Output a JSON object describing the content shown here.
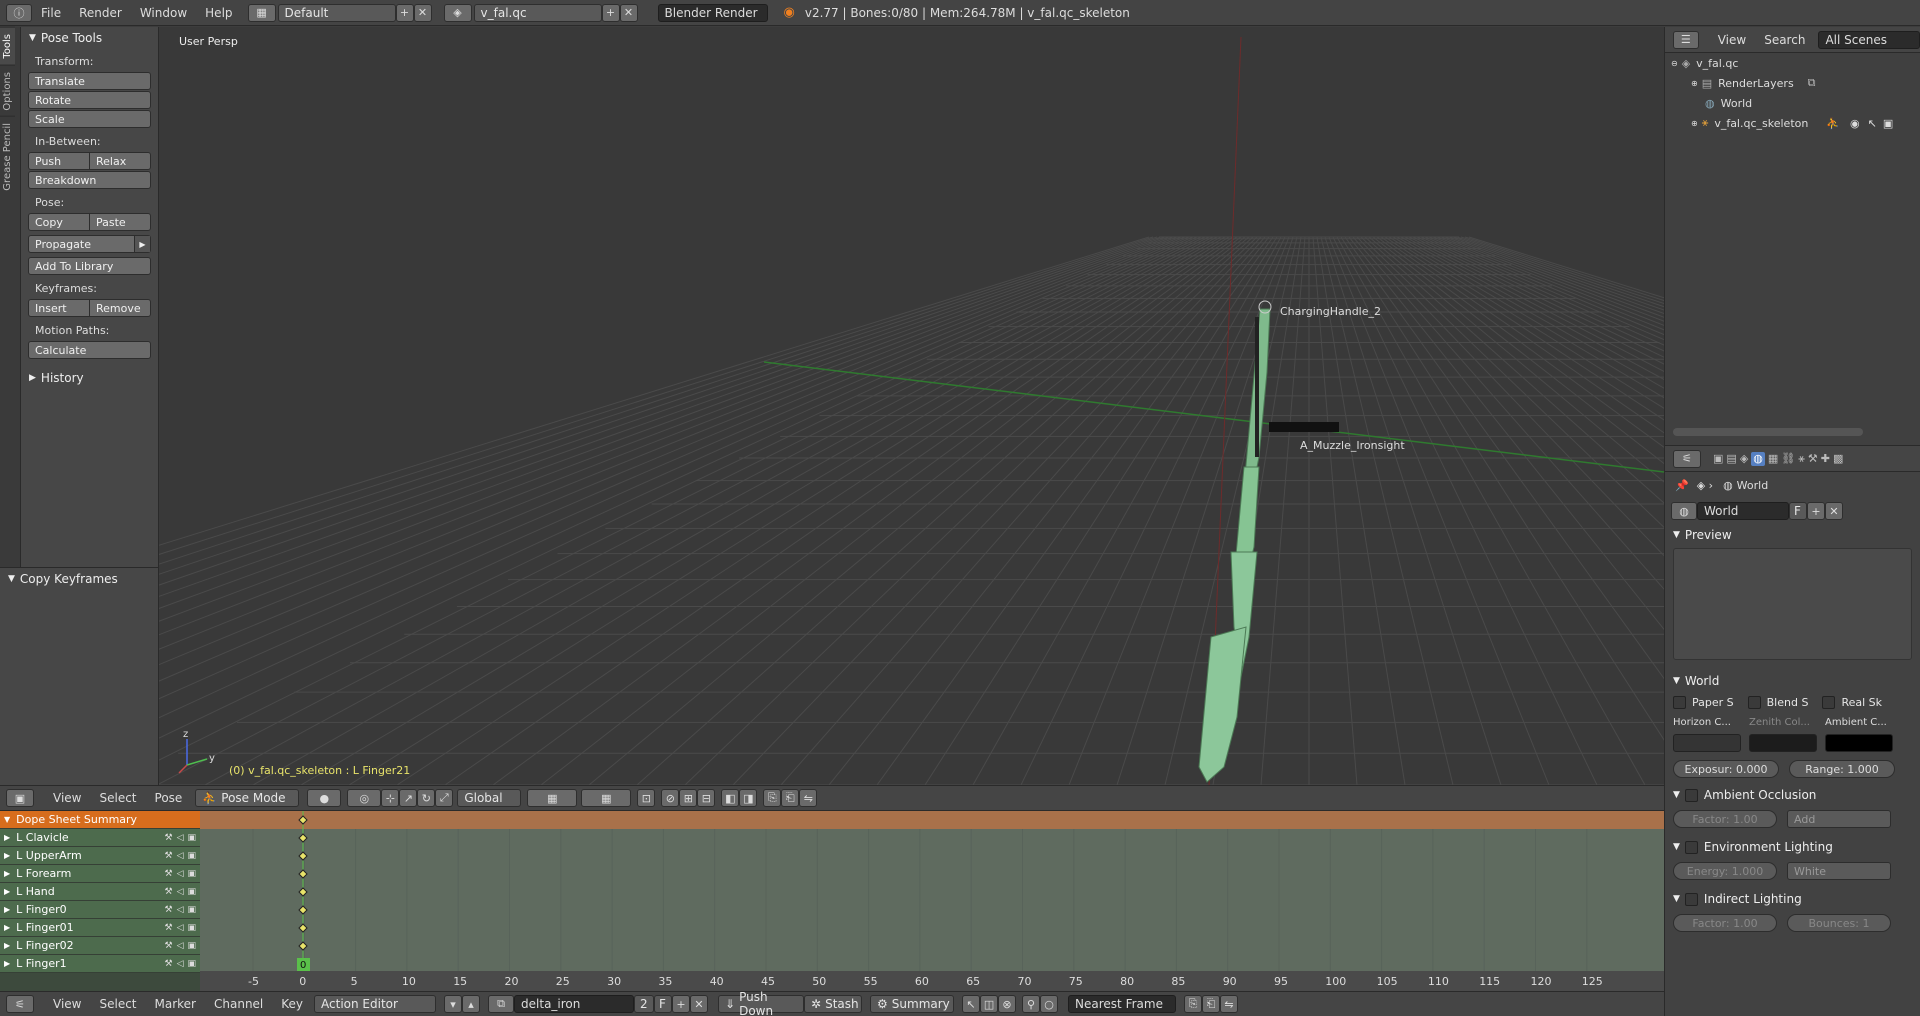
{
  "topbar": {
    "menus": [
      "File",
      "Render",
      "Window",
      "Help"
    ],
    "layout": "Default",
    "scene": "v_fal.qc",
    "engine": "Blender Render",
    "stats": "v2.77 | Bones:0/80 | Mem:264.78M | v_fal.qc_skeleton"
  },
  "toolshelf": {
    "tabs": [
      "Tools",
      "Options",
      "Grease Pencil"
    ],
    "title": "Pose Tools",
    "transform_label": "Transform:",
    "translate": "Translate",
    "rotate": "Rotate",
    "scale": "Scale",
    "inbetween_label": "In-Between:",
    "push": "Push",
    "relax": "Relax",
    "breakdown": "Breakdown",
    "pose_label": "Pose:",
    "copy": "Copy",
    "paste": "Paste",
    "propagate": "Propagate",
    "add_library": "Add To Library",
    "keyframes_label": "Keyframes:",
    "insert": "Insert",
    "remove": "Remove",
    "motion_label": "Motion Paths:",
    "calculate": "Calculate",
    "history": "History",
    "copy_keyframes": "Copy Keyframes"
  },
  "viewport": {
    "view_label": "User Persp",
    "status": "(0) v_fal.qc_skeleton : L Finger21",
    "bone_labels": [
      "ChargingHandle_2",
      "A_Muzzle_Ironsight"
    ],
    "axis_x": "x",
    "axis_y": "y",
    "axis_z": "z"
  },
  "view3d_header": {
    "menus": [
      "View",
      "Select",
      "Pose"
    ],
    "mode": "Pose Mode",
    "orientation": "Global"
  },
  "dopesheet": {
    "channels": [
      "Dope Sheet Summary",
      "L Clavicle",
      "L UpperArm",
      "L Forearm",
      "L Hand",
      "L Finger0",
      "L Finger01",
      "L Finger02",
      "L Finger1"
    ],
    "ruler": [
      "-5",
      "0",
      "5",
      "10",
      "15",
      "20",
      "25",
      "30",
      "35",
      "40",
      "45",
      "50",
      "55",
      "60",
      "65",
      "70",
      "75",
      "80",
      "85",
      "90",
      "95",
      "100",
      "105",
      "110",
      "115",
      "120",
      "125"
    ],
    "current_frame": "0"
  },
  "dopesheet_header": {
    "menus": [
      "View",
      "Select",
      "Marker",
      "Channel",
      "Key"
    ],
    "editor_mode": "Action Editor",
    "action": "delta_iron",
    "users": "2",
    "fake": "F",
    "push_down": "Push Down",
    "stash": "Stash",
    "summary": "Summary",
    "snap": "Nearest Frame"
  },
  "outliner": {
    "menus": [
      "View",
      "Search"
    ],
    "filter": "All Scenes",
    "items": [
      "v_fal.qc",
      "RenderLayers",
      "World",
      "v_fal.qc_skeleton"
    ]
  },
  "properties": {
    "breadcrumb": "World",
    "world_name": "World",
    "fake": "F",
    "preview": "Preview",
    "world_panel": "World",
    "paper": "Paper S",
    "blend": "Blend S",
    "real": "Real Sk",
    "horizon": "Horizon C...",
    "zenith": "Zenith Col...",
    "ambient": "Ambient C...",
    "exposure": "Exposur: 0.000",
    "range": "Range:  1.000",
    "ao": "Ambient Occlusion",
    "ao_factor": "Factor:          1.00",
    "ao_mode": "Add",
    "env": "Environment Lighting",
    "env_energy": "Energy:  1.000",
    "env_color": "White",
    "indirect": "Indirect Lighting",
    "ind_factor": "Factor:          1.00",
    "ind_bounces": "Bounces:        1"
  },
  "colors": {
    "summary": "#d76d1d",
    "channel": "#4d6b4d",
    "keyframe": "#e8e36a",
    "frame_marker": "#5ac04a",
    "mesh": "#8cc79a"
  }
}
